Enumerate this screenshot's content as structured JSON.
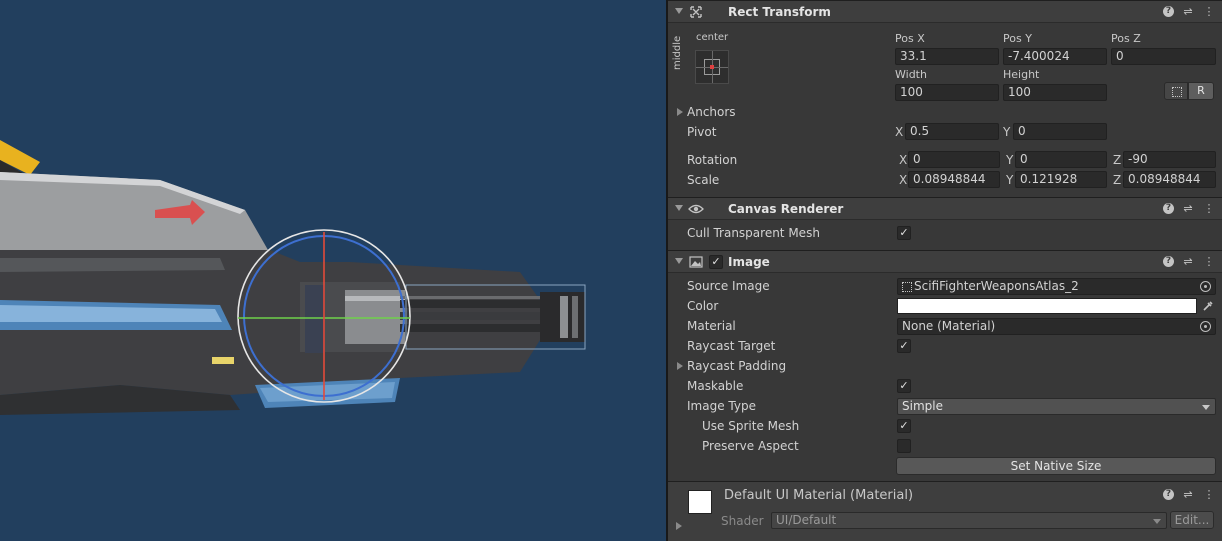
{
  "rect_transform": {
    "title": "Rect Transform",
    "anchor_preset": {
      "horizontal": "center",
      "vertical": "middle"
    },
    "headers": [
      "Pos X",
      "Pos Y",
      "Pos Z"
    ],
    "pos_x": "33.1",
    "pos_y": "-7.400024",
    "pos_z": "0",
    "size_headers": [
      "Width",
      "Height"
    ],
    "width": "100",
    "height": "100",
    "r_button": "R",
    "anchors_label": "Anchors",
    "pivot_label": "Pivot",
    "pivot_x": "0.5",
    "pivot_y": "0",
    "rotation_label": "Rotation",
    "rotation": {
      "x": "0",
      "y": "0",
      "z": "-90"
    },
    "scale_label": "Scale",
    "scale": {
      "x": "0.08948844",
      "y": "0.121928",
      "z": "0.08948844"
    },
    "axis": {
      "x": "X",
      "y": "Y",
      "z": "Z"
    }
  },
  "canvas_renderer": {
    "title": "Canvas Renderer",
    "cull_label": "Cull Transparent Mesh",
    "cull_checked": true
  },
  "image": {
    "title": "Image",
    "enabled": true,
    "source_image_label": "Source Image",
    "source_image": "ScifiFighterWeaponsAtlas_2",
    "color_label": "Color",
    "color_value": "#ffffff",
    "material_label": "Material",
    "material": "None (Material)",
    "raycast_target_label": "Raycast Target",
    "raycast_padding_label": "Raycast Padding",
    "maskable_label": "Maskable",
    "image_type_label": "Image Type",
    "image_type": "Simple",
    "use_sprite_mesh_label": "Use Sprite Mesh",
    "preserve_aspect_label": "Preserve Aspect",
    "set_native_size": "Set Native Size"
  },
  "material_panel": {
    "title": "Default UI Material (Material)",
    "shader_label": "Shader",
    "shader": "UI/Default",
    "edit_button": "Edit..."
  },
  "icons": {
    "check": "✓",
    "help": "?",
    "settings": "⇌",
    "more": "⋮",
    "eyedropper": "eyedropper-icon"
  },
  "colors": {
    "scene_background": "#223f5e",
    "inspector_background": "#383838"
  }
}
